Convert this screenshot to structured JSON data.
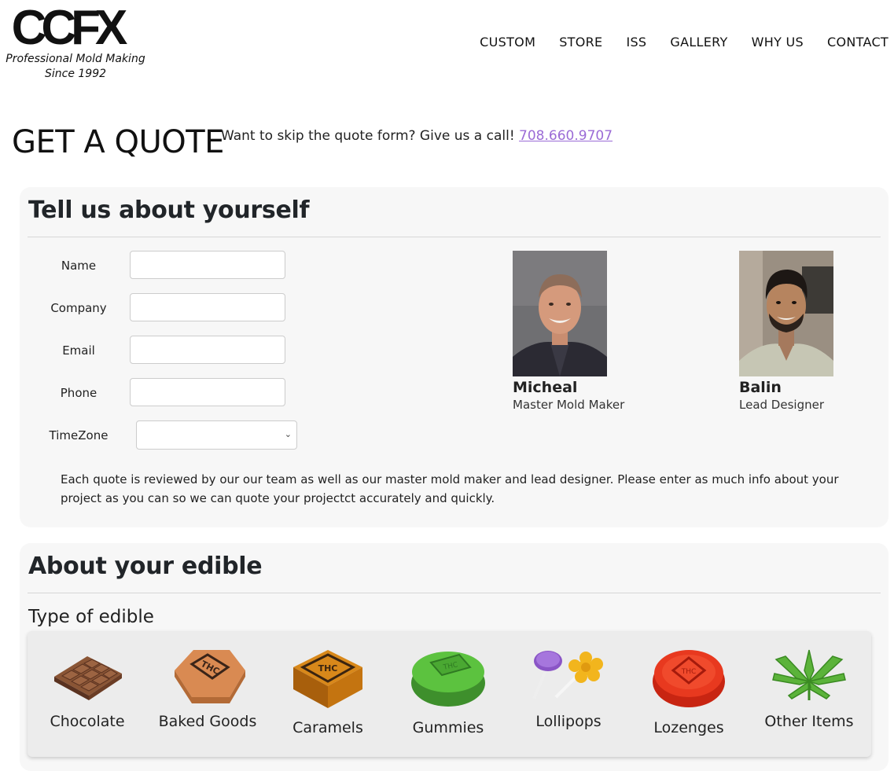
{
  "logo": {
    "mark": "CCFX",
    "tagline_1": "Professional Mold Making",
    "tagline_2": "Since 1992"
  },
  "nav": [
    "CUSTOM",
    "STORE",
    "ISS",
    "GALLERY",
    "WHY US",
    "CONTACT"
  ],
  "quote": {
    "title": "GET A QUOTE",
    "sub": "Want to skip the quote form? Give us a call!",
    "phone": "708.660.9707"
  },
  "about_you": {
    "heading": "Tell us about yourself",
    "fields": [
      {
        "label": "Name",
        "value": ""
      },
      {
        "label": "Company",
        "value": ""
      },
      {
        "label": "Email",
        "value": ""
      },
      {
        "label": "Phone",
        "value": ""
      },
      {
        "label": "TimeZone",
        "value": ""
      }
    ],
    "people": [
      {
        "name": "Micheal",
        "role": "Master Mold Maker"
      },
      {
        "name": "Balin",
        "role": "Lead Designer"
      }
    ],
    "note": "Each quote is reviewed by our our team as well as our master mold maker and lead designer. Please enter as much info about your project as you can so we can quote your projectct accurately and quickly."
  },
  "about_edible": {
    "heading": "About your edible",
    "type_heading": "Type of edible",
    "types": [
      "Chocolate",
      "Baked Goods",
      "Caramels",
      "Gummies",
      "Lollipops",
      "Lozenges",
      "Other Items"
    ],
    "colors": {
      "chocolate": "#7a4a2e",
      "baked": "#d98a52",
      "caramel": "#c8780f",
      "gummy": "#4fa93a",
      "lozenge": "#e0341c",
      "other": "#5bb33a"
    }
  }
}
